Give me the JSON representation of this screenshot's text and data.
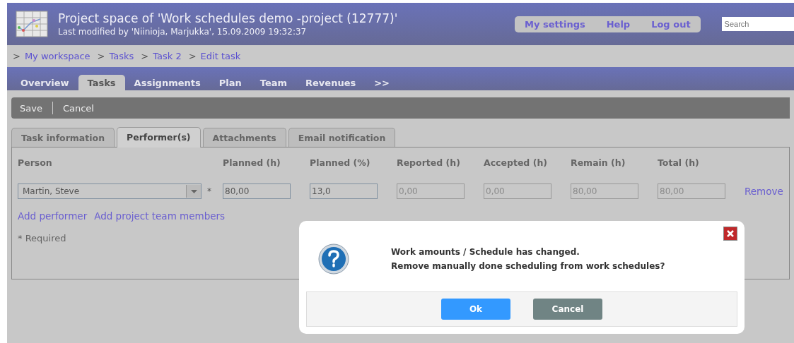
{
  "header": {
    "title": "Project space of 'Work schedules demo -project (12777)'",
    "subtitle": "Last modified by 'Niinioja, Marjukka', 15.09.2009 19:32:37",
    "links": [
      "My settings",
      "Help",
      "Log out"
    ],
    "search": {
      "placeholder": "Search"
    }
  },
  "breadcrumb": {
    "separator": ">",
    "items": [
      "My workspace",
      "Tasks",
      "Task 2",
      "Edit task"
    ]
  },
  "nav_tabs": [
    {
      "label": "Overview",
      "selected": false
    },
    {
      "label": "Tasks",
      "selected": true
    },
    {
      "label": "Assignments",
      "selected": false
    },
    {
      "label": "Plan",
      "selected": false
    },
    {
      "label": "Team",
      "selected": false
    },
    {
      "label": "Revenues",
      "selected": false
    },
    {
      "label": ">>",
      "selected": false
    }
  ],
  "toolbar": [
    "Save",
    "Cancel"
  ],
  "sub_tabs": [
    {
      "label": "Task information",
      "selected": false
    },
    {
      "label": "Performer(s)",
      "selected": true
    },
    {
      "label": "Attachments",
      "selected": false
    },
    {
      "label": "Email notification",
      "selected": false
    }
  ],
  "performers": {
    "columns": [
      "Person",
      "Planned (h)",
      "Planned (%)",
      "Reported (h)",
      "Accepted (h)",
      "Remain (h)",
      "Total (h)"
    ],
    "rows": [
      {
        "person": "Martin, Steve",
        "required_mark": "*",
        "action": "Remove",
        "fields": [
          {
            "value": "80,00",
            "disabled": false
          },
          {
            "value": "13,0",
            "disabled": false
          },
          {
            "value": "0,00",
            "disabled": true
          },
          {
            "value": "0,00",
            "disabled": true
          },
          {
            "value": "80,00",
            "disabled": true
          },
          {
            "value": "80,00",
            "disabled": true
          }
        ]
      }
    ],
    "links": [
      "Add performer",
      "Add project team members"
    ],
    "note": "* Required"
  },
  "dialog": {
    "lines": [
      "Work amounts / Schedule has changed.",
      "Remove manually done scheduling from work schedules?"
    ],
    "buttons": [
      {
        "label": "Ok",
        "kind": "primary"
      },
      {
        "label": "Cancel",
        "kind": "secondary"
      }
    ]
  }
}
